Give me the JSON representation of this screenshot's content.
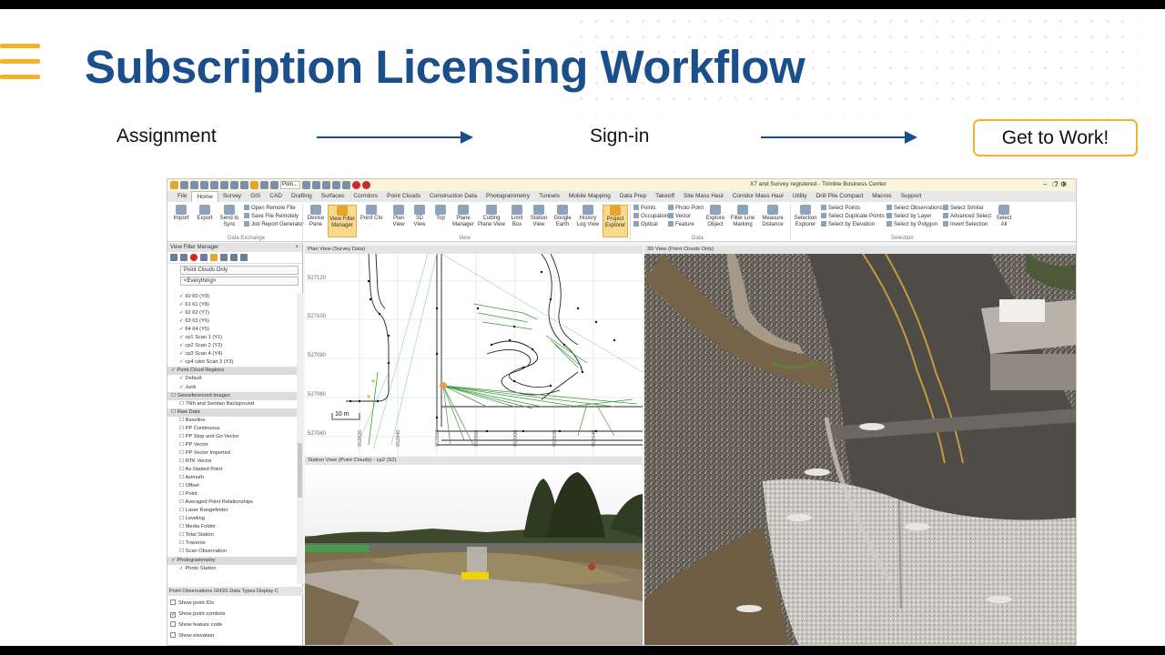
{
  "slide": {
    "title": "Subscription Licensing Workflow",
    "steps": [
      "Assignment",
      "Sign-in",
      "Get to Work!"
    ],
    "colors": {
      "title": "#1b4f8c",
      "accent": "#f2b32a"
    }
  },
  "app": {
    "window_title": "X7 and Survey registered - Trimble Business Center",
    "qat_point_field": "Poin...",
    "tabs": [
      "File",
      "Home",
      "Survey",
      "GIS",
      "CAD",
      "Drafting",
      "Surfaces",
      "Corridors",
      "Point Clouds",
      "Construction Data",
      "Photogrammetry",
      "Tunnels",
      "Mobile Mapping",
      "Data Prep",
      "Takeoff",
      "Site Mass Haul",
      "Corridor Mass Haul",
      "Utility",
      "Drill Pile Compact",
      "Macros",
      "Support"
    ],
    "active_tab": "Home",
    "ribbon": {
      "data_exchange": {
        "label": "Data Exchange",
        "import": "Import",
        "export": "Export",
        "send_to_sync": "Send to Sync",
        "open_remote": "Open Remote File",
        "save_remote": "Save File Remotely",
        "job_report": "Job Report Generator"
      },
      "view": {
        "label": "View",
        "device_pane": "Device Pane",
        "view_filter_manager": "View Filter Manager",
        "point_cloud": "Point Clo",
        "plan_view": "Plan View",
        "3d_view": "3D View",
        "top": "Top",
        "plane_manager": "Plane Manager",
        "cutting_plane": "Cutting Plane View",
        "limit_box": "Limit Box",
        "station_view": "Station View",
        "google_earth": "Google Earth",
        "history_log": "History Log View",
        "project_explorer": "Project Explorer"
      },
      "data": {
        "label": "Data",
        "points": "Points",
        "occupation": "Occupation",
        "optical": "Optical",
        "photo_point": "Photo Point",
        "vector": "Vector",
        "feature": "Feature",
        "explore_object": "Explore Object",
        "filter_line_marking": "Filter Line Marking",
        "measure_distance": "Measure Distance"
      },
      "selection": {
        "label": "Selection",
        "selection_explorer": "Selection Explorer",
        "select_points": "Select Points",
        "select_duplicate": "Select Duplicate Points",
        "select_by_elevation": "Select by Elevation",
        "select_observations": "Select Observations",
        "select_by_layer": "Select by Layer",
        "select_by_polygon": "Select by Polygon",
        "select_similar": "Select Similar",
        "advanced_select": "Advanced Select",
        "invert_selection": "Invert Selection",
        "select_all": "Select All"
      }
    },
    "left_panel": {
      "title": "View Filter Manager",
      "filter_value": "Point Clouds Only",
      "layer_value": "<Everything>",
      "tree": [
        {
          "label": "60 60 (Y9)",
          "checked": true,
          "indent": 1,
          "header": false
        },
        {
          "label": "61 61 (Y8)",
          "checked": true,
          "indent": 1,
          "header": false
        },
        {
          "label": "62 62 (Y7)",
          "checked": true,
          "indent": 1,
          "header": false
        },
        {
          "label": "63 63 (Y6)",
          "checked": true,
          "indent": 1,
          "header": false
        },
        {
          "label": "64 64 (Y5)",
          "checked": true,
          "indent": 1,
          "header": false
        },
        {
          "label": "cp1 Scan 1 (Y1)",
          "checked": true,
          "indent": 1,
          "header": false
        },
        {
          "label": "cp2 Scan 2 (Y2)",
          "checked": true,
          "indent": 1,
          "header": false
        },
        {
          "label": "cp3 Scan 4 (Y4)",
          "checked": true,
          "indent": 1,
          "header": false
        },
        {
          "label": "cp4 cdot Scan 3 (Y3)",
          "checked": true,
          "indent": 1,
          "header": false
        },
        {
          "label": "Point Cloud Regions",
          "checked": true,
          "indent": 0,
          "header": true
        },
        {
          "label": "Default",
          "checked": true,
          "indent": 1,
          "header": false
        },
        {
          "label": "Junk",
          "checked": true,
          "indent": 1,
          "header": false
        },
        {
          "label": "Georeferenced Images",
          "checked": false,
          "indent": 0,
          "header": true
        },
        {
          "label": "76th and Seridan Background",
          "checked": false,
          "indent": 1,
          "header": false
        },
        {
          "label": "Raw Data",
          "checked": false,
          "indent": 0,
          "header": true
        },
        {
          "label": "Baseline",
          "checked": false,
          "indent": 1,
          "header": false
        },
        {
          "label": "PP Continuous",
          "checked": false,
          "indent": 1,
          "header": false
        },
        {
          "label": "PP Stop and Go Vector",
          "checked": false,
          "indent": 1,
          "header": false
        },
        {
          "label": "PP Vector",
          "checked": false,
          "indent": 1,
          "header": false
        },
        {
          "label": "PP Vector Imported",
          "checked": false,
          "indent": 1,
          "header": false
        },
        {
          "label": "RTK Vector",
          "checked": false,
          "indent": 1,
          "header": false
        },
        {
          "label": "As-Staked Point",
          "checked": false,
          "indent": 1,
          "header": false
        },
        {
          "label": "Azimuth",
          "checked": false,
          "indent": 1,
          "header": false
        },
        {
          "label": "Offset",
          "checked": false,
          "indent": 1,
          "header": false
        },
        {
          "label": "Point",
          "checked": false,
          "indent": 1,
          "header": false
        },
        {
          "label": "Averaged Point Relationships",
          "checked": false,
          "indent": 1,
          "header": false
        },
        {
          "label": "Laser Rangefinder",
          "checked": false,
          "indent": 1,
          "header": false
        },
        {
          "label": "Leveling",
          "checked": false,
          "indent": 1,
          "header": false
        },
        {
          "label": "Media Folder",
          "checked": false,
          "indent": 1,
          "header": false
        },
        {
          "label": "Total Station",
          "checked": false,
          "indent": 1,
          "header": false
        },
        {
          "label": "Traverse",
          "checked": false,
          "indent": 1,
          "header": false
        },
        {
          "label": "Scan Observation",
          "checked": false,
          "indent": 1,
          "header": false
        },
        {
          "label": "Photogrammetry",
          "checked": true,
          "indent": 0,
          "header": true
        },
        {
          "label": "Photo Station",
          "checked": true,
          "indent": 1,
          "header": false
        }
      ],
      "bottom_tabs": "Point  Observations  GNSS Data Types  Display C",
      "options": [
        {
          "label": "Show point IDs",
          "checked": false
        },
        {
          "label": "Show point symbols",
          "checked": true
        },
        {
          "label": "Show feature code",
          "checked": false
        },
        {
          "label": "Show elevation",
          "checked": false
        }
      ]
    },
    "plan_view": {
      "title": "Plan View (Survey Data)",
      "y_labels": [
        "527120",
        "527100",
        "527080",
        "527060",
        "527040"
      ],
      "x_labels": [
        "952820",
        "952840",
        "952860",
        "952880",
        "952900",
        "952920",
        "952940"
      ],
      "scale_label": "10 m"
    },
    "station_view": {
      "title": "Station View (Point Clouds) - cp2 (S2)"
    },
    "view_3d": {
      "title": "3D View (Point Clouds Only)"
    }
  }
}
